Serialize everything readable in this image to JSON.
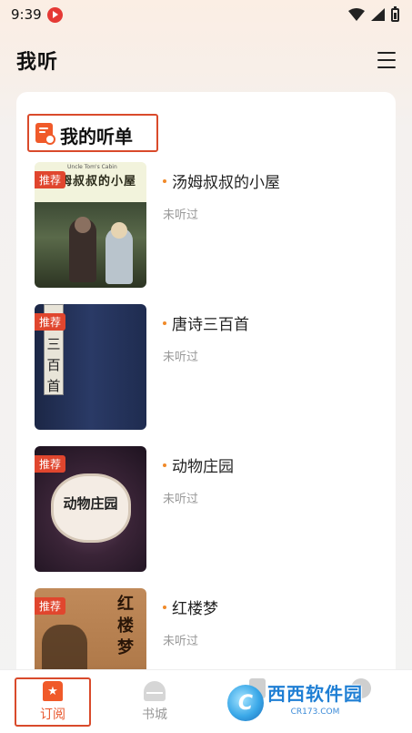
{
  "status_bar": {
    "time": "9:39"
  },
  "header": {
    "title": "我听"
  },
  "section": {
    "title": "我的听单"
  },
  "books": [
    {
      "title": "汤姆叔叔的小屋",
      "status": "未听过",
      "badge": "推荐",
      "cover_text": "汤姆叔叔的小屋",
      "cover_subtext": "Uncle Tom's Cabin"
    },
    {
      "title": "唐诗三百首",
      "status": "未听过",
      "badge": "推荐",
      "cover_text": "唐诗三百首"
    },
    {
      "title": "动物庄园",
      "status": "未听过",
      "badge": "推荐",
      "cover_text": "动物庄园"
    },
    {
      "title": "红楼梦",
      "status": "未听过",
      "badge": "推荐",
      "cover_text": "红楼梦"
    }
  ],
  "tabs": [
    {
      "label": "订阅",
      "active": true
    },
    {
      "label": "书城",
      "active": false
    }
  ],
  "watermark": {
    "text": "西西软件园",
    "sub": "CR173.COM"
  },
  "colors": {
    "accent": "#e8562c",
    "highlight_border": "#d94a2b",
    "badge": "#e0462e"
  }
}
